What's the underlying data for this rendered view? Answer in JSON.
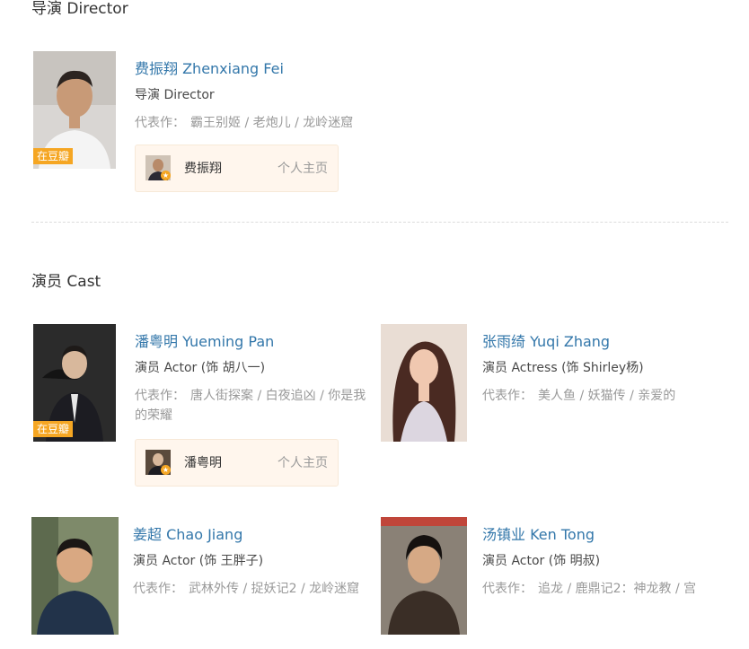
{
  "director_section": {
    "title": "导演 Director",
    "people": [
      {
        "name": "费振翔 Zhenxiang Fei",
        "role": "导演 Director",
        "works_label": "代表作：",
        "works": "霸王别姬 / 老炮儿 / 龙岭迷窟",
        "badge": "在豆瓣",
        "homepage": {
          "name": "费振翔",
          "link": "个人主页"
        }
      }
    ]
  },
  "cast_section": {
    "title": "演员 Cast",
    "people": [
      {
        "name": "潘粤明 Yueming Pan",
        "role": "演员 Actor (饰 胡八一)",
        "works_label": "代表作：",
        "works": "唐人街探案 / 白夜追凶 / 你是我的荣耀",
        "badge": "在豆瓣",
        "homepage": {
          "name": "潘粤明",
          "link": "个人主页"
        }
      },
      {
        "name": "张雨绮 Yuqi Zhang",
        "role": "演员 Actress (饰 Shirley杨)",
        "works_label": "代表作：",
        "works": "美人鱼 / 妖猫传 / 亲爱的"
      },
      {
        "name": "姜超 Chao Jiang",
        "role": "演员 Actor (饰 王胖子)",
        "works_label": "代表作：",
        "works": "武林外传 / 捉妖记2 / 龙岭迷窟"
      },
      {
        "name": "汤镇业 Ken Tong",
        "role": "演员 Actor (饰 明叔)",
        "works_label": "代表作：",
        "works": "追龙 / 鹿鼎记2：神龙教 / 宫"
      }
    ]
  },
  "colors": {
    "link_blue": "#3377aa",
    "badge_orange": "#f5a623",
    "homecard_bg": "#fff6ed"
  }
}
